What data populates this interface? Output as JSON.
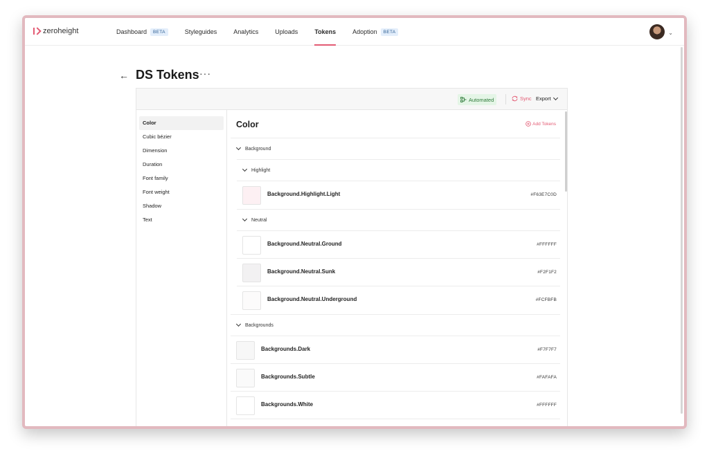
{
  "app": {
    "logo_text": "zeroheight"
  },
  "nav": {
    "items": [
      {
        "label": "Dashboard",
        "badge": "BETA",
        "active": false
      },
      {
        "label": "Styleguides",
        "badge": "",
        "active": false
      },
      {
        "label": "Analytics",
        "badge": "",
        "active": false
      },
      {
        "label": "Uploads",
        "badge": "",
        "active": false
      },
      {
        "label": "Tokens",
        "badge": "",
        "active": true
      },
      {
        "label": "Adoption",
        "badge": "BETA",
        "active": false
      }
    ]
  },
  "page": {
    "back_icon": "←",
    "title": "DS Tokens",
    "more": "···"
  },
  "toolbar": {
    "automated": "Automated",
    "sync": "Sync",
    "export": "Export"
  },
  "sidebar": {
    "items": [
      "Color",
      "Cubic bézier",
      "Dimension",
      "Duration",
      "Font family",
      "Font weight",
      "Shadow",
      "Text"
    ],
    "active_index": 0
  },
  "content": {
    "title": "Color",
    "add_tokens": "Add Tokens",
    "groups": {
      "background": "Background",
      "highlight": "Highlight",
      "neutral": "Neutral",
      "backgrounds": "Backgrounds"
    },
    "tokens": [
      {
        "name": "Background.Highlight.Light",
        "value": "#F63E7C0D",
        "swatch": "#fdf0f3"
      },
      {
        "name": "Background.Neutral.Ground",
        "value": "#FFFFFF",
        "swatch": "#ffffff"
      },
      {
        "name": "Background.Neutral.Sunk",
        "value": "#F2F1F2",
        "swatch": "#f2f1f2"
      },
      {
        "name": "Background.Neutral.Underground",
        "value": "#FCFBFB",
        "swatch": "#fcfbfb"
      },
      {
        "name": "Backgrounds.Dark",
        "value": "#F7F7F7",
        "swatch": "#f7f7f7"
      },
      {
        "name": "Backgrounds.Subtle",
        "value": "#FAFAFA",
        "swatch": "#fafafa"
      },
      {
        "name": "Backgrounds.White",
        "value": "#FFFFFF",
        "swatch": "#ffffff"
      }
    ]
  },
  "colors": {
    "accent": "#e35a73",
    "automated_bg": "#e4f5e6",
    "badge_bg": "#e3eefb"
  }
}
